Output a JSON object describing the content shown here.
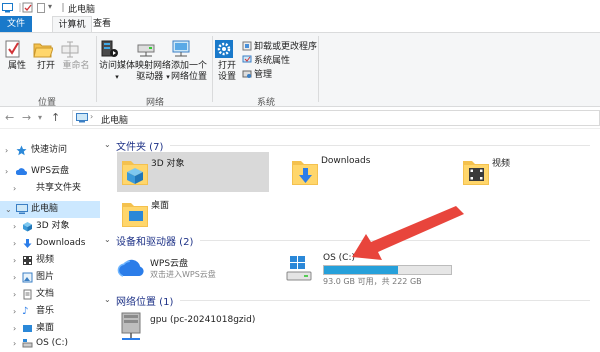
{
  "window": {
    "title": "此电脑"
  },
  "tabs": [
    {
      "label": "文件"
    },
    {
      "label": "计算机"
    },
    {
      "label": "查看"
    }
  ],
  "ribbon": {
    "location_group": {
      "label": "位置",
      "buttons": [
        {
          "label": "属性",
          "icon": "properties-icon",
          "disabled": false
        },
        {
          "label": "打开",
          "icon": "open-folder-icon",
          "disabled": false
        },
        {
          "label": "重命名",
          "icon": "rename-icon",
          "disabled": true
        }
      ]
    },
    "network_group": {
      "label": "网络",
      "buttons": [
        {
          "label_line1": "访问媒体",
          "label_line2": "",
          "icon": "media-server-icon"
        },
        {
          "label_line1": "映射网络",
          "label_line2": "驱动器",
          "icon": "map-drive-icon"
        },
        {
          "label_line1": "添加一个",
          "label_line2": "网络位置",
          "icon": "network-location-icon"
        }
      ]
    },
    "system_group": {
      "label": "系统",
      "open_settings": {
        "label_line1": "打开",
        "label_line2": "设置"
      },
      "items": [
        {
          "label": "卸载或更改程序"
        },
        {
          "label": "系统属性"
        },
        {
          "label": "管理"
        }
      ]
    }
  },
  "address": {
    "path": "此电脑"
  },
  "nav_pane": {
    "items": [
      {
        "label": "快速访问",
        "icon": "star-icon"
      },
      {
        "label": "WPS云盘",
        "icon": "cloud-icon"
      },
      {
        "label": "共享文件夹",
        "icon": "shared-folder-icon"
      },
      {
        "label": "此电脑",
        "icon": "computer-icon"
      },
      {
        "label": "3D 对象",
        "icon": "3d-objects-icon"
      },
      {
        "label": "Downloads",
        "icon": "download-icon"
      },
      {
        "label": "视频",
        "icon": "video-icon"
      },
      {
        "label": "图片",
        "icon": "pictures-icon"
      },
      {
        "label": "文档",
        "icon": "documents-icon"
      },
      {
        "label": "音乐",
        "icon": "music-icon"
      },
      {
        "label": "桌面",
        "icon": "desktop-icon"
      },
      {
        "label": "OS (C:)",
        "icon": "drive-icon"
      }
    ]
  },
  "sections": {
    "folders": {
      "title": "文件夹 (7)",
      "items": [
        {
          "label": "3D 对象"
        },
        {
          "label": "Downloads"
        },
        {
          "label": "视频"
        },
        {
          "label": "桌面"
        }
      ]
    },
    "devices": {
      "title": "设备和驱动器 (2)",
      "wps": {
        "name": "WPS云盘",
        "desc": "双击进入WPS云盘"
      },
      "drive": {
        "name": "OS (C:)",
        "free_text": "93.0 GB 可用，共 222 GB",
        "used_fraction": 0.58
      }
    },
    "network": {
      "title": "网络位置 (1)",
      "items": [
        {
          "label": "gpu (pc-20241018gzid)"
        }
      ]
    }
  },
  "colors": {
    "accent": "#1979ca",
    "selection": "#cce8ff",
    "drive_fill": "#26a0da",
    "annotation_arrow": "#e8453c"
  }
}
